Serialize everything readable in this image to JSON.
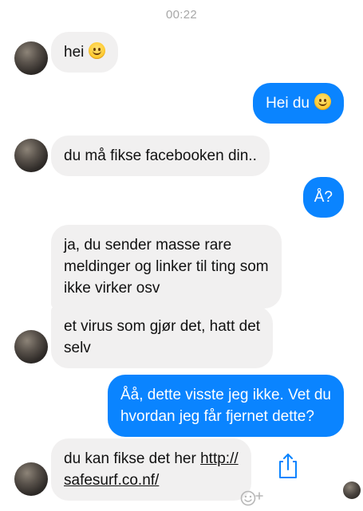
{
  "header": {
    "time": "00:22"
  },
  "messages": [
    {
      "text": "hei"
    },
    {
      "text": "Hei du"
    },
    {
      "text": "du må fikse facebooken din.."
    },
    {
      "text": "Å?"
    },
    {
      "lines": [
        "ja, du sender masse rare",
        "meldinger og linker til ting som",
        "ikke virker osv"
      ]
    },
    {
      "lines": [
        "et virus som gjør det, hatt det",
        "selv"
      ]
    },
    {
      "lines": [
        "Åå, dette visste jeg ikke. Vet du",
        "hvordan jeg får fjernet dette?"
      ]
    },
    {
      "pre_link": "du kan fikse det her ",
      "link_part1": "http://",
      "link_part2": "safesurf.co.nf/"
    }
  ],
  "icons": {
    "emoji": "slightly-smiling-face",
    "share": "share-icon",
    "reaction": "add-reaction-icon"
  },
  "colors": {
    "outgoing": "#0a84ff",
    "incoming": "#f1f0f0"
  }
}
